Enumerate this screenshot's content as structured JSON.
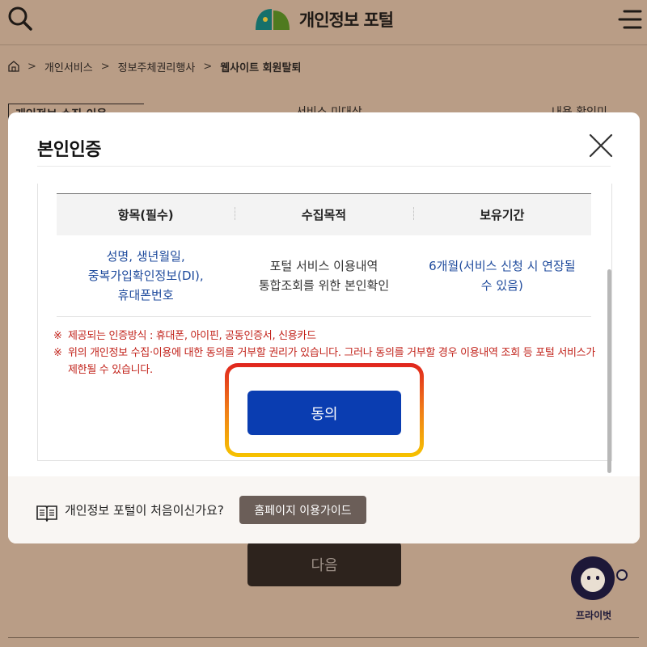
{
  "header": {
    "logo_text": "개인정보 포털",
    "search_icon": "search-icon",
    "menu_icon": "hamburger-menu-icon"
  },
  "breadcrumb": {
    "home_icon": "home-icon",
    "items": [
      "개인서비스",
      "정보주체권리행사",
      "웹사이트 회원탈퇴"
    ],
    "separator": ">"
  },
  "background_tabs": [
    "개인정보 수집·이용",
    "서비스 미대상",
    "내용 확인미"
  ],
  "background_next_button": "다음",
  "chatbot": {
    "label": "프라이벗"
  },
  "modal": {
    "title": "본인인증",
    "close_icon": "close-icon",
    "table": {
      "headers": [
        "항목(필수)",
        "수집목적",
        "보유기간"
      ],
      "rows": [
        {
          "items_lines": [
            "성명, 생년월일,",
            "중복가입확인정보(DI),",
            "휴대폰번호"
          ],
          "purpose_lines": [
            "포털 서비스 이용내역",
            "통합조회를 위한 본인확인"
          ],
          "period_lines": [
            "6개월(서비스 신청 시 연장될",
            "수 있음)"
          ]
        }
      ]
    },
    "notes": [
      {
        "mark": "※",
        "text": "제공되는 인증방식 : 휴대폰, 아이핀, 공동인증서, 신용카드"
      },
      {
        "mark": "※",
        "text": "위의 개인정보 수집·이용에 대한 동의를 거부할 권리가 있습니다. 그러나 동의를 거부할 경우 이용내역 조회 등 포털 서비스가 제한될 수 있습니다."
      }
    ],
    "agree_button": "동의",
    "footer": {
      "book_icon": "book-icon",
      "question": "개인정보 포털이 처음이신가요?",
      "guide_button": "홈페이지 이용가이드"
    }
  },
  "colors": {
    "overlay": "#b99d86",
    "primary_button": "#0a3db1",
    "notice_red": "#c2231b",
    "link_blue": "#1e4a9c",
    "guide_button": "#6b5e58",
    "highlight_top": "#e0241d",
    "highlight_bottom": "#f6c300"
  }
}
